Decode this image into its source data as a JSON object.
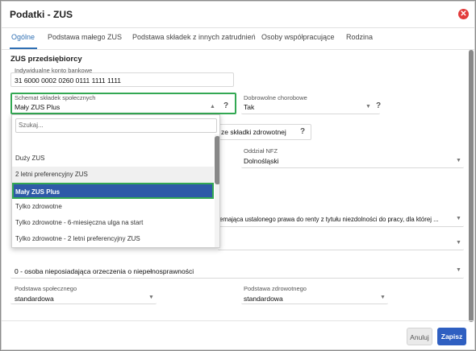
{
  "window": {
    "title": "Podatki - ZUS"
  },
  "tabs": [
    "Ogólne",
    "Podstawa małego ZUS",
    "Podstawa składek z innych zatrudnień",
    "Osoby współpracujące",
    "Rodzina"
  ],
  "zus": {
    "section_title": "ZUS przedsiębiorcy",
    "bank_label": "Indywidualne konto bankowe",
    "bank_value": "31 6000 0002 0260 0111 1111 1111",
    "scheme_label": "Schemat składek społecznych",
    "scheme_value": "Mały ZUS Plus",
    "sickness_label": "Dobrowolne chorobowe",
    "sickness_value": "Tak",
    "health_fragment": "ze składki zdrowotnej",
    "nfz_label": "Oddział NFZ",
    "nfz_value": "Dolnośląski",
    "pension_fragment": "emająca ustalonego prawa do renty z tytułu niezdolności do pracy, dla której ...",
    "disability_value": "0 - osoba nieposiadająca orzeczenia o niepełnosprawności",
    "social_base_label": "Podstawa społecznego",
    "social_base_value": "standardowa",
    "health_base_label": "Podstawa zdrowotnego",
    "health_base_value": "standardowa",
    "help_mark": "?"
  },
  "dropdown": {
    "placeholder": "Szukaj...",
    "options": [
      "Duży ZUS",
      "2 letni preferencyjny ZUS",
      "Mały ZUS Plus",
      "Tylko zdrowotne",
      "Tylko zdrowotne - 6-miesięczna ulga na start",
      "Tylko zdrowotne - 2 letni preferencyjny ZUS"
    ],
    "selected": "Mały ZUS Plus"
  },
  "footer": {
    "cancel": "Anuluj",
    "save": "Zapisz"
  },
  "colors": {
    "accent": "#2f6fb3",
    "primary_button": "#2f5fc1",
    "highlight_border": "#33a853",
    "close": "#e23b3b"
  }
}
